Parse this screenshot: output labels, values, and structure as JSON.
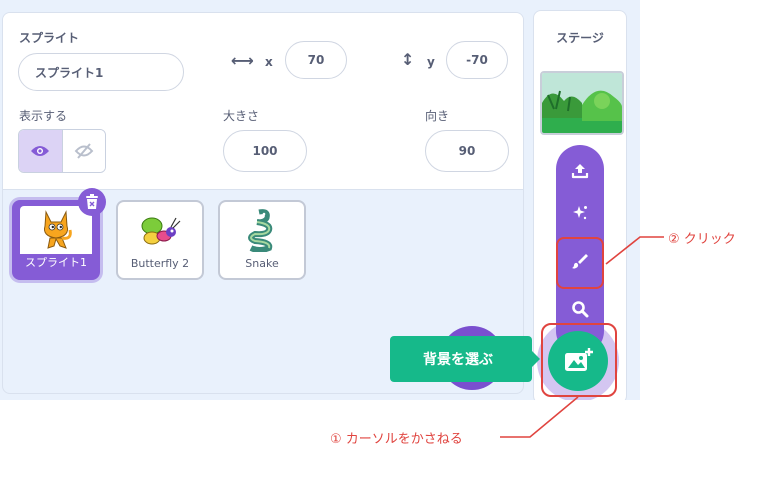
{
  "sprite_info": {
    "sprite_label": "スプライト",
    "sprite_name": "スプライト1",
    "x_label": "x",
    "x_value": "70",
    "y_label": "y",
    "y_value": "-70",
    "show_label": "表示する",
    "size_label": "大きさ",
    "size_value": "100",
    "direction_label": "向き",
    "direction_value": "90"
  },
  "sprites": [
    {
      "name": "スプライト1",
      "selected": true
    },
    {
      "name": "Butterfly 2",
      "selected": false
    },
    {
      "name": "Snake",
      "selected": false
    }
  ],
  "stage": {
    "title": "ステージ"
  },
  "backdrop_menu": {
    "tooltip": "背景を選ぶ",
    "items": [
      "upload-icon",
      "surprise-icon",
      "paint-icon",
      "search-icon"
    ],
    "main_icon": "backdrop-icon"
  },
  "annotations": {
    "step1": "① カーソルをかさねる",
    "step2": "② クリック"
  },
  "colors": {
    "accent": "#855cd6",
    "backdrop_button": "#16b98a",
    "annotation": "#e0443f"
  }
}
